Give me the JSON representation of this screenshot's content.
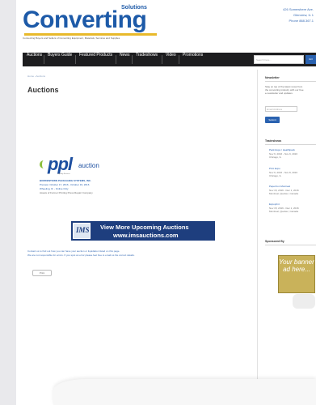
{
  "header": {
    "logo_text": "Converting",
    "logo_sub": "Solutions",
    "tagline": "Connecting Buyers and Sellers of Converting Equipment, Materials, Services and Supplies",
    "address_lines": [
      "426 Somewhere Ave.",
      "Glenview, IL 1",
      "Phone 888.367.1"
    ]
  },
  "nav": {
    "items": [
      "Auctions",
      "Buyers Guide",
      "Featured Products",
      "News",
      "Tradeshows",
      "Video",
      "Promotions"
    ],
    "search_placeholder": "Search here...",
    "search_button": "GO"
  },
  "main": {
    "breadcrumb": "Home › Auctions",
    "title": "Auctions",
    "ppl_logo": "ppl",
    "ppl_logo_word": "auction",
    "ppl_sub": "Liquidity Services",
    "event_title": "BORDENTOWN PACKAGING SYSTEMS, INC.",
    "event_line2": "Preview: October 17, 2016 - October 19, 2016",
    "event_line3": "Wheeling, Ill. - Online Only",
    "event_line4": "Assets of Former Printing Press Repair Company",
    "banner_badge": "IMS",
    "banner_line1": "View More Upcoming Auctions",
    "banner_line2": "www.imsauctions.com",
    "note_line1": "Contact us to find out how you can have your auction or liquidation listed on this page.",
    "note_line2": "We are not responsible for errors. If you spot an error please feel free to email us the correct details.",
    "print_label": "Print"
  },
  "sidebar": {
    "newsletter_heading": "Newsletter",
    "newsletter_text": [
      "Stay on top of the latest news from",
      "the converting industry with our free",
      "e-newsletter and updates."
    ],
    "email_placeholder": "Email Address",
    "submit_label": "Submit",
    "tradeshows_heading": "Tradeshows",
    "events": [
      {
        "name": "Pack Expo / Healthpack",
        "date": "Nov 6, 2016 - Nov 9, 2016",
        "place": "Chicago, IL"
      },
      {
        "name": "Print Expo",
        "date": "Nov 6, 2016 - Nov 8, 2016",
        "place": "Chicago, IL"
      },
      {
        "name": "PaperCon Montreal",
        "date": "Nov 15, 2016 - Dec 1, 2016",
        "place": "Montreal, Quebec, Canada"
      },
      {
        "name": "Expoprint",
        "date": "Nov 15, 2016 - Dec 1, 2016",
        "place": "Montreal, Quebec, Canada"
      }
    ],
    "sponsored_heading": "Sponsored By",
    "ad_text": "Your banner ad here..."
  }
}
